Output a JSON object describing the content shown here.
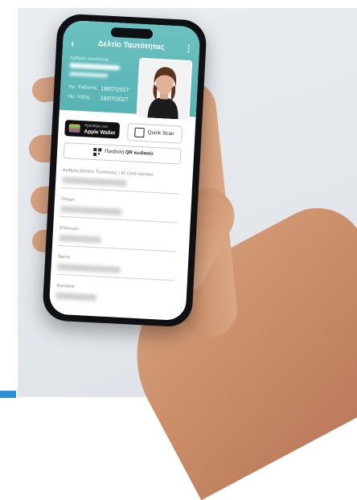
{
  "app": {
    "title": "Δελτίο Ταυτότητας",
    "back_icon": "chevron-left-icon",
    "menu_icon": "more-vertical-icon"
  },
  "card": {
    "id_label": "Αριθμός ταυτότητας",
    "issue_label": "Ημ. Έκδοσης",
    "issue_date": "18/07/2017",
    "expiry_label": "Ημ. Λήξης",
    "expiry_date": "18/07/2027"
  },
  "actions": {
    "wallet_small": "Προσθήκη στο",
    "wallet_big": "Apple Wallet",
    "quick_scan": "Quick Scan",
    "qr_prefix": "Προβολή",
    "qr_bold": "QR κωδικού"
  },
  "fields": [
    {
      "label": "Αριθμός Δελτίου Ταυτότητας / ID Card Number"
    },
    {
      "label": "Όνομα"
    },
    {
      "label": "Επώνυμο"
    },
    {
      "label": "Name"
    },
    {
      "label": "Surname"
    }
  ],
  "colors": {
    "header_teal": "#5fb8b8",
    "background": "#e6e9ed",
    "accent_blue": "#2f8fd6"
  }
}
